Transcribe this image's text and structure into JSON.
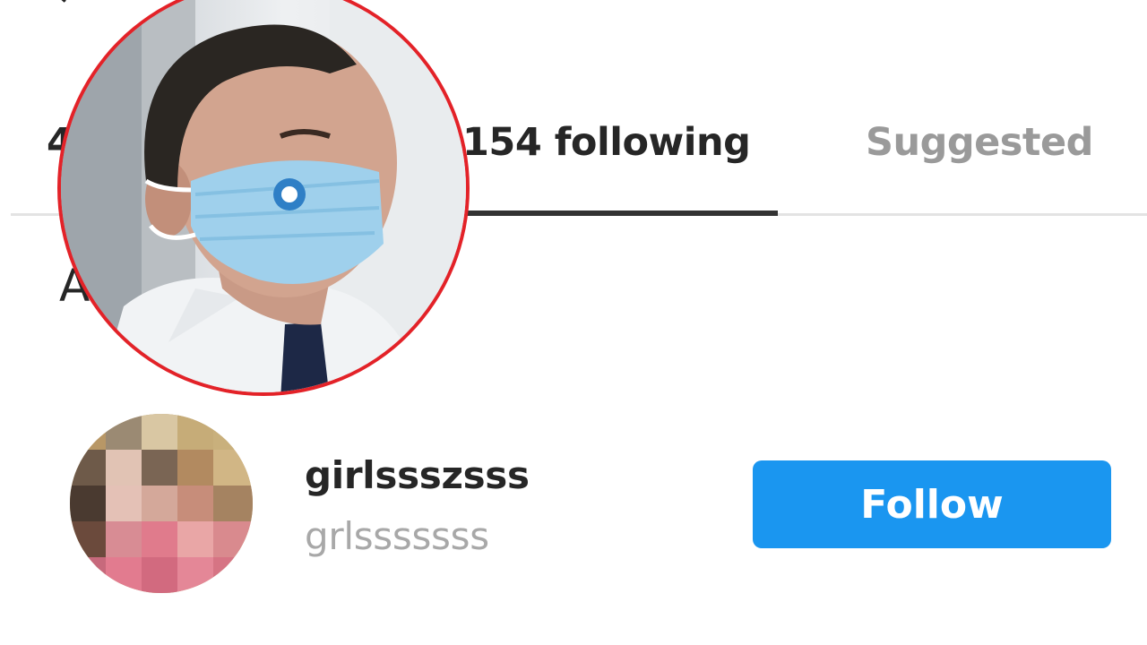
{
  "header": {
    "back_icon": "back-arrow-icon",
    "title_fragment": "Q",
    "right_fragment": ""
  },
  "tabs": [
    {
      "label": "4",
      "active": false
    },
    {
      "label": "154 following",
      "active": true
    },
    {
      "label": "Suggested",
      "active": false
    }
  ],
  "section": {
    "title_fragment": "A"
  },
  "user": {
    "username": "girlssszsss",
    "fullname": "grlsssssss",
    "follow_label": "Follow"
  },
  "colors": {
    "accent": "#1a96f0",
    "inset_border": "#e32228",
    "tab_active": "#262626",
    "tab_inactive": "#9a9a9a"
  }
}
